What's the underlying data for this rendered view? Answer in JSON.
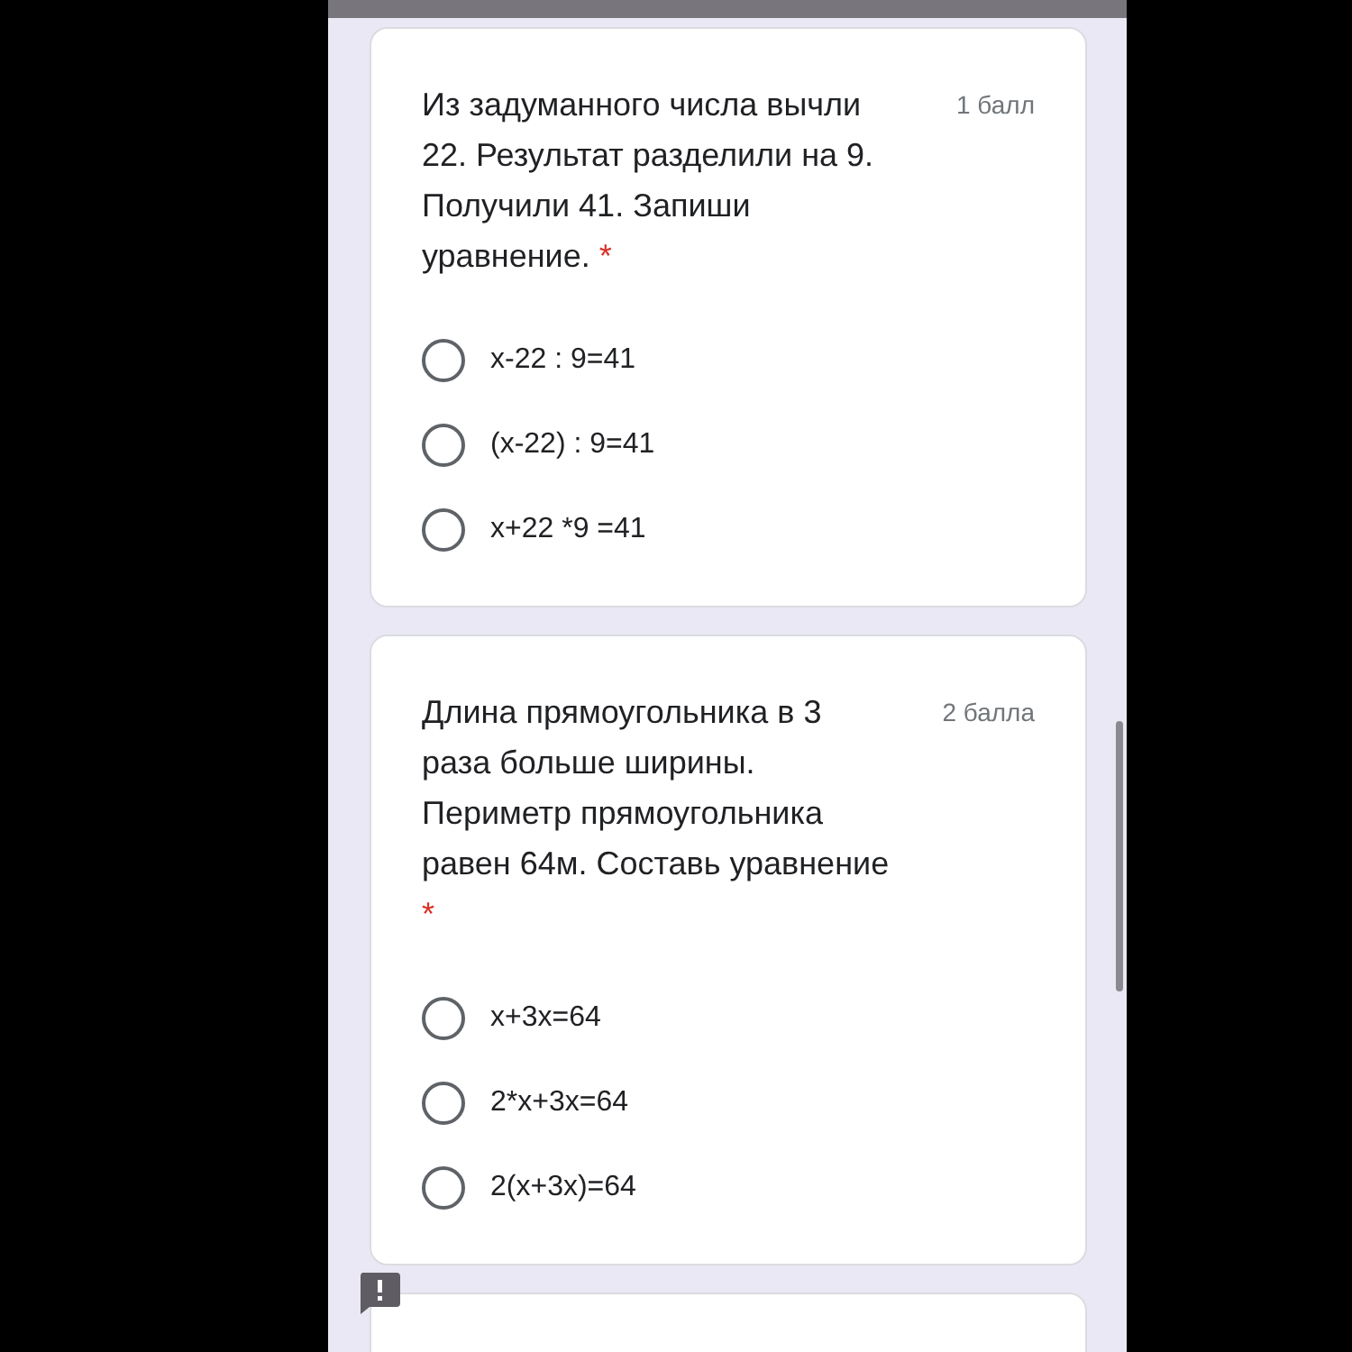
{
  "questions": [
    {
      "text": "Из задуманного числа вычли 22. Результат разделили на 9. Получили 41. Запиши уравнение.",
      "required": true,
      "required_mark": "*",
      "points": "1 балл",
      "options": [
        {
          "label": "x-22 : 9=41",
          "selected": false
        },
        {
          "label": "(x-22) : 9=41",
          "selected": false
        },
        {
          "label": "x+22 *9 =41",
          "selected": false
        }
      ]
    },
    {
      "text": "Длина прямоугольника в 3 раза больше ширины. Периметр прямоугольника равен 64м. Составь уравнение",
      "required": true,
      "required_mark": "*",
      "points": "2 балла",
      "options": [
        {
          "label": "x+3x=64",
          "selected": false
        },
        {
          "label": "2*x+3x=64",
          "selected": false
        },
        {
          "label": "2(x+3x)=64",
          "selected": false
        }
      ]
    }
  ]
}
